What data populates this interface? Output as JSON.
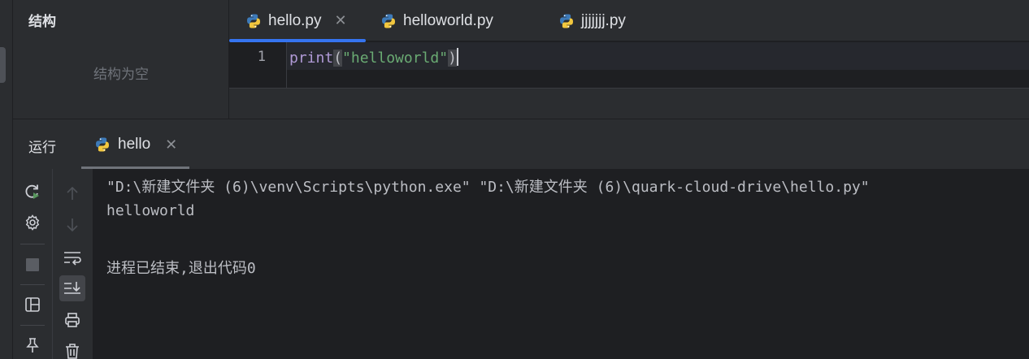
{
  "structure": {
    "title": "结构",
    "empty_text": "结构为空"
  },
  "editor": {
    "tabs": [
      {
        "label": "hello.py",
        "active": true,
        "closable": true
      },
      {
        "label": "helloworld.py",
        "active": false
      },
      {
        "label": "jjjjjjj.py",
        "active": false
      }
    ],
    "line_number": "1",
    "code": {
      "fn": "print",
      "open": "(",
      "string": "\"helloworld\"",
      "close": ")"
    }
  },
  "run": {
    "title": "运行",
    "tab_label": "hello",
    "output": [
      "\"D:\\新建文件夹 (6)\\venv\\Scripts\\python.exe\" \"D:\\新建文件夹 (6)\\quark-cloud-drive\\hello.py\"",
      "helloworld",
      "",
      "进程已结束,退出代码0"
    ]
  },
  "colors": {
    "accent": "#3574f0",
    "background": "#1e1f22",
    "panel": "#2b2d30",
    "string": "#6aab73",
    "function": "#b09ad6"
  },
  "icons": [
    "python-icon",
    "close-icon",
    "rerun-icon",
    "settings-icon",
    "stop-icon",
    "layout-icon",
    "pin-icon",
    "arrow-up-icon",
    "arrow-down-icon",
    "soft-wrap-icon",
    "scroll-to-end-icon",
    "print-icon",
    "trash-icon"
  ]
}
